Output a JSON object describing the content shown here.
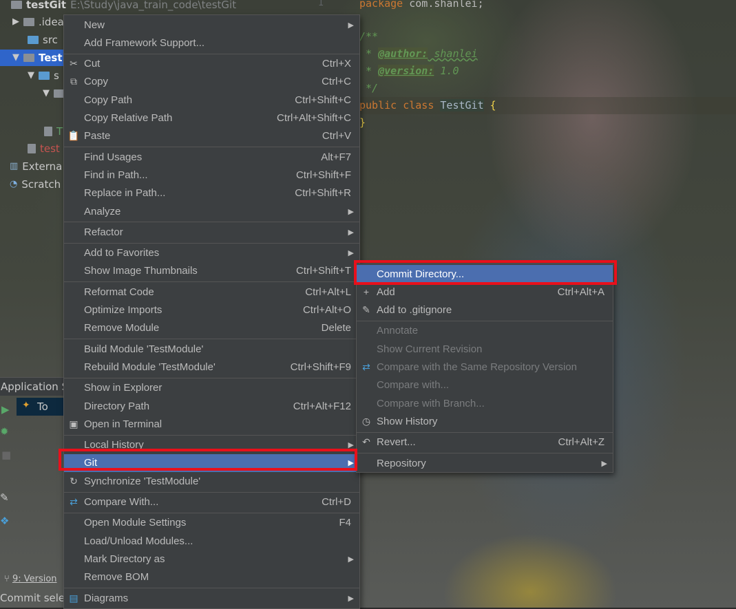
{
  "project": {
    "root": "testGit",
    "root_path": "E:\\Study\\java_train_code\\testGit",
    "tree": [
      {
        "label": ".idea",
        "icon": "folder-icon"
      },
      {
        "label": "src",
        "icon": "folder-icon"
      },
      {
        "label": "Test",
        "icon": "module-folder-icon"
      },
      {
        "label": "s",
        "icon": "folder-icon"
      },
      {
        "label": "",
        "icon": "package-icon"
      },
      {
        "label": "T",
        "icon": "java-file-icon"
      },
      {
        "label": "test",
        "icon": "iml-file-icon"
      },
      {
        "label": "Externa",
        "icon": "libraries-icon"
      },
      {
        "label": "Scratch",
        "icon": "scratches-icon"
      }
    ]
  },
  "editor": {
    "line_number": "1",
    "lines": [
      {
        "kind": "package",
        "keyword": "package",
        "rest": " com.shanlei;"
      },
      {
        "kind": "blank"
      },
      {
        "kind": "comment",
        "text": "/**"
      },
      {
        "kind": "tag",
        "prefix": " * ",
        "tag": "@author:",
        "value": " shanlei"
      },
      {
        "kind": "tag",
        "prefix": " * ",
        "tag": "@version:",
        "value": " 1.0"
      },
      {
        "kind": "comment",
        "text": " */"
      },
      {
        "kind": "class",
        "kw1": "public",
        "kw2": "class",
        "name": "TestGit",
        "brace": "{"
      },
      {
        "kind": "close",
        "brace": "}"
      }
    ]
  },
  "bottom": {
    "app_servers": "Application S",
    "run_item": "To",
    "version_tab": "9: Version",
    "status": "Commit selec"
  },
  "main_menu": [
    {
      "label": "New",
      "submenu": true
    },
    {
      "label": "Add Framework Support..."
    },
    {
      "sep": true
    },
    {
      "label": "Cut",
      "shortcut": "Ctrl+X",
      "icon": "cut-icon"
    },
    {
      "label": "Copy",
      "shortcut": "Ctrl+C",
      "icon": "copy-icon"
    },
    {
      "label": "Copy Path",
      "shortcut": "Ctrl+Shift+C"
    },
    {
      "label": "Copy Relative Path",
      "shortcut": "Ctrl+Alt+Shift+C"
    },
    {
      "label": "Paste",
      "shortcut": "Ctrl+V",
      "icon": "paste-icon"
    },
    {
      "sep": true
    },
    {
      "label": "Find Usages",
      "shortcut": "Alt+F7"
    },
    {
      "label": "Find in Path...",
      "shortcut": "Ctrl+Shift+F"
    },
    {
      "label": "Replace in Path...",
      "shortcut": "Ctrl+Shift+R"
    },
    {
      "label": "Analyze",
      "submenu": true
    },
    {
      "sep": true
    },
    {
      "label": "Refactor",
      "submenu": true
    },
    {
      "sep": true
    },
    {
      "label": "Add to Favorites",
      "submenu": true
    },
    {
      "label": "Show Image Thumbnails",
      "shortcut": "Ctrl+Shift+T"
    },
    {
      "sep": true
    },
    {
      "label": "Reformat Code",
      "shortcut": "Ctrl+Alt+L"
    },
    {
      "label": "Optimize Imports",
      "shortcut": "Ctrl+Alt+O"
    },
    {
      "label": "Remove Module",
      "shortcut": "Delete"
    },
    {
      "sep": true
    },
    {
      "label": "Build Module 'TestModule'"
    },
    {
      "label": "Rebuild Module 'TestModule'",
      "shortcut": "Ctrl+Shift+F9"
    },
    {
      "sep": true
    },
    {
      "label": "Show in Explorer"
    },
    {
      "label": "Directory Path",
      "shortcut": "Ctrl+Alt+F12"
    },
    {
      "label": "Open in Terminal",
      "icon": "terminal-icon"
    },
    {
      "sep": true
    },
    {
      "label": "Local History",
      "submenu": true
    },
    {
      "label": "Git",
      "submenu": true,
      "active": true
    },
    {
      "label": "Synchronize 'TestModule'",
      "icon": "sync-icon"
    },
    {
      "sep": true
    },
    {
      "label": "Compare With...",
      "shortcut": "Ctrl+D",
      "icon": "compare-icon"
    },
    {
      "sep": true
    },
    {
      "label": "Open Module Settings",
      "shortcut": "F4"
    },
    {
      "label": "Load/Unload Modules..."
    },
    {
      "label": "Mark Directory as",
      "submenu": true
    },
    {
      "label": "Remove BOM"
    },
    {
      "sep": true
    },
    {
      "label": "Diagrams",
      "submenu": true,
      "icon": "diagram-icon"
    }
  ],
  "git_menu": [
    {
      "label": "Commit Directory...",
      "active": true
    },
    {
      "label": "Add",
      "shortcut": "Ctrl+Alt+A",
      "icon": "plus-icon"
    },
    {
      "label": "Add to .gitignore",
      "icon": "gitignore-icon"
    },
    {
      "sep": true
    },
    {
      "label": "Annotate",
      "disabled": true
    },
    {
      "label": "Show Current Revision",
      "disabled": true
    },
    {
      "label": "Compare with the Same Repository Version",
      "disabled": true,
      "icon": "compare-icon"
    },
    {
      "label": "Compare with...",
      "disabled": true
    },
    {
      "label": "Compare with Branch...",
      "disabled": true
    },
    {
      "label": "Show History",
      "icon": "clock-icon"
    },
    {
      "sep": true
    },
    {
      "label": "Revert...",
      "shortcut": "Ctrl+Alt+Z",
      "icon": "revert-icon"
    },
    {
      "sep": true
    },
    {
      "label": "Repository",
      "submenu": true
    }
  ],
  "colors": {
    "menu_bg": "#3c3f41",
    "highlight": "#4b6eaf",
    "annotation_box": "#e8101b",
    "disabled_text": "#7a7c7e"
  }
}
